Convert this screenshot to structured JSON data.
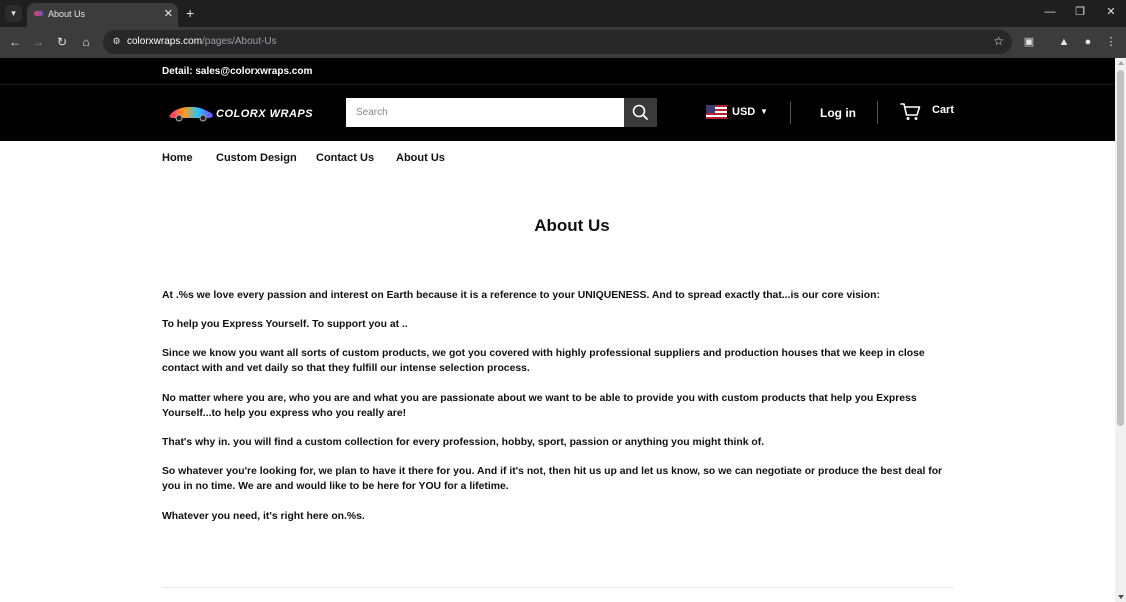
{
  "browser": {
    "tab": {
      "title": "About Us"
    },
    "url": {
      "domain": "colorxwraps.com",
      "path": "/pages/About-Us"
    },
    "icons": {
      "tab_list": "chevron-down-icon",
      "close_tab": "close-icon",
      "new_tab": "plus-icon",
      "minimize": "minimize-icon",
      "restore": "restore-icon",
      "close_window": "close-icon",
      "back": "arrow-left-icon",
      "forward": "arrow-right-icon",
      "reload": "reload-icon",
      "home": "home-icon",
      "site_info": "tune-icon",
      "bookmark": "star-icon",
      "extensions": "puzzle-icon",
      "labs": "flask-icon",
      "profile": "person-icon",
      "menu": "kebab-menu-icon"
    }
  },
  "topbar": {
    "detail": "Detail: sales@colorxwraps.com"
  },
  "header": {
    "logo_text": "COLORX WRAPS",
    "search_placeholder": "Search",
    "currency": "USD",
    "login": "Log in",
    "cart": "Cart"
  },
  "nav": [
    "Home",
    "Custom Design",
    "Contact Us",
    "About Us"
  ],
  "page": {
    "title": "About Us",
    "paragraphs": [
      "At .%s we love every passion and interest on Earth because it is a reference to your UNIQUENESS. And to spread exactly that...is our core vision:",
      "To help you Express Yourself. To support you at ..",
      "Since we know you want all sorts of custom products, we got you covered with highly professional suppliers and production houses that we keep in close contact with and vet daily so that they fulfill our intense selection process.",
      "No matter where you are, who you are and what you are passionate about we want to be able to provide you with custom products that help you Express Yourself...to help you express who you really are!",
      "That's why in. you will find a custom collection for every profession, hobby, sport, passion or anything you might think of.",
      "So whatever you're looking for, we plan to have it there for you. And if it's not, then hit us up and let us know, so we can negotiate or produce the best deal for you in no time. We are and would like to be here for YOU for a lifetime.",
      "Whatever you need, it's right here on.%s."
    ]
  },
  "colors": {
    "chrome_tabbar": "#1f1f1f",
    "chrome_toolbar": "#3c3c3c",
    "site_header": "#000000",
    "text": "#111111"
  }
}
